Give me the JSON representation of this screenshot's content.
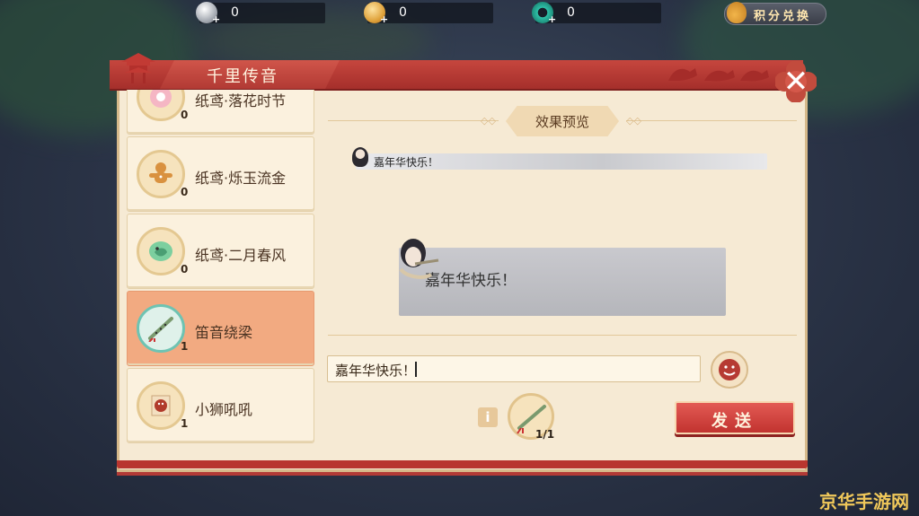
{
  "currency": [
    {
      "icon": "silver-coin-icon",
      "value": "0"
    },
    {
      "icon": "gold-coin-icon",
      "value": "0"
    },
    {
      "icon": "jade-token-icon",
      "value": "0"
    }
  ],
  "exchange": {
    "label": "积分兑换",
    "icon": "money-bag-icon"
  },
  "dialog": {
    "title": "千里传音"
  },
  "items": [
    {
      "name": "纸鸢·落花时节",
      "count": "0",
      "icon": "flower-kite-icon"
    },
    {
      "name": "纸鸢·烁玉流金",
      "count": "0",
      "icon": "gingerbread-kite-icon"
    },
    {
      "name": "纸鸢·二月春风",
      "count": "0",
      "icon": "green-dragon-kite-icon"
    },
    {
      "name": "笛音绕梁",
      "count": "1",
      "icon": "flute-icon",
      "selected": true
    },
    {
      "name": "小狮吼吼",
      "count": "1",
      "icon": "lion-scroll-icon"
    }
  ],
  "preview": {
    "label": "效果预览",
    "small_bubble_text": "嘉年华快乐！",
    "big_bubble_text": "嘉年华快乐！"
  },
  "input": {
    "value": "嘉年华快乐！"
  },
  "selected_item": {
    "count": "1/1"
  },
  "send_button": {
    "label": "发送"
  },
  "watermark": {
    "text": "京华手游网"
  },
  "colors": {
    "accent_red": "#c2332f",
    "panel": "#f6ead4",
    "selected": "#f2aa81"
  }
}
